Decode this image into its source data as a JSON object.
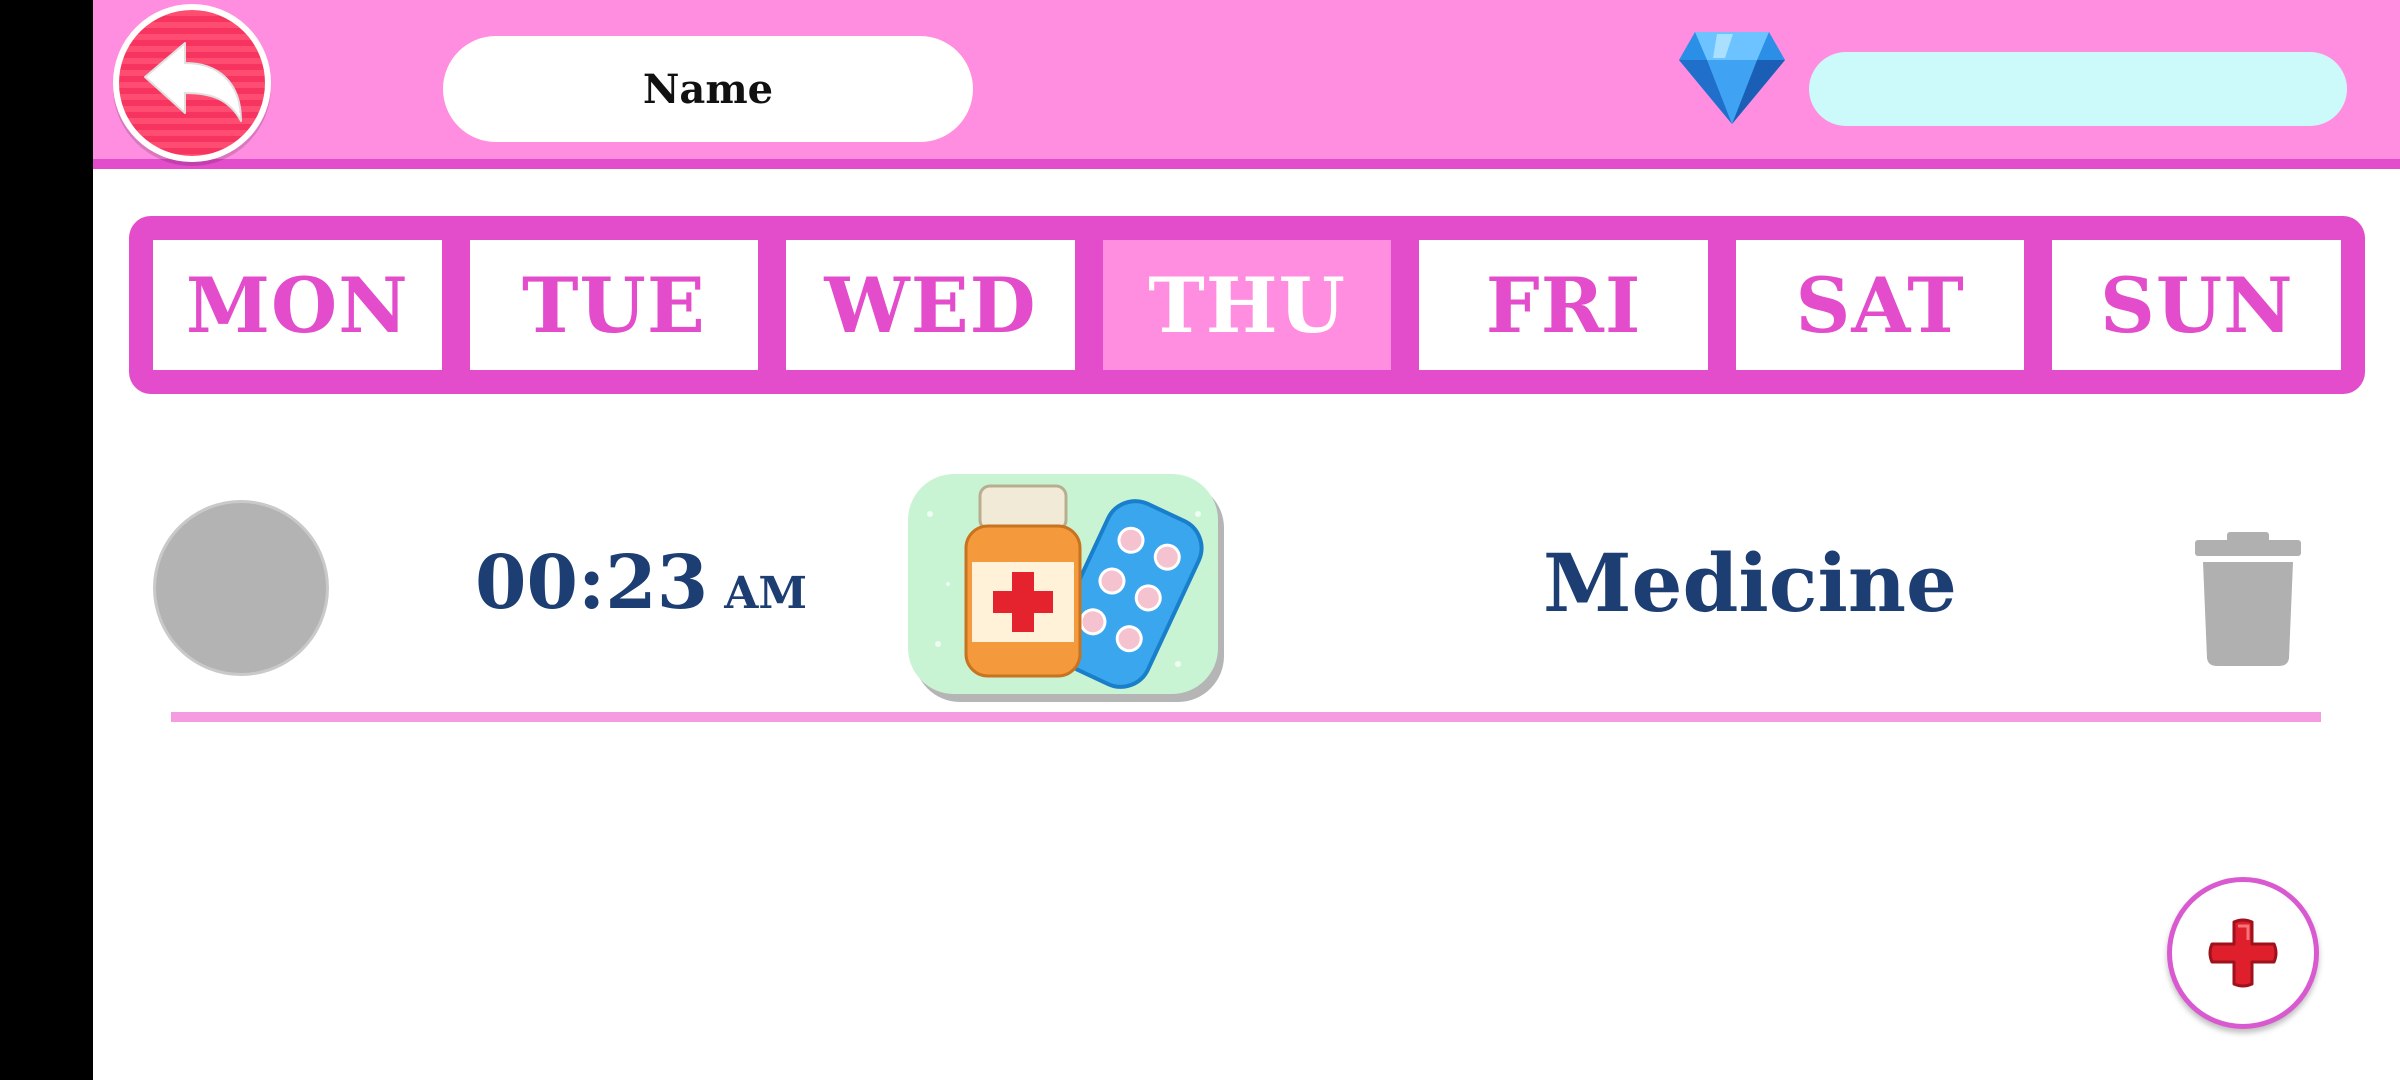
{
  "header": {
    "name_label": "Name",
    "back_icon": "back-arrow-icon",
    "gem_icon": "diamond-icon",
    "gem_value": ""
  },
  "days": [
    {
      "label": "MON",
      "active": false
    },
    {
      "label": "TUE",
      "active": false
    },
    {
      "label": "WED",
      "active": false
    },
    {
      "label": "THU",
      "active": true
    },
    {
      "label": "FRI",
      "active": false
    },
    {
      "label": "SAT",
      "active": false
    },
    {
      "label": "SUN",
      "active": false
    }
  ],
  "reminder": {
    "time": "00:23",
    "ampm": "AM",
    "title": "Medicine",
    "image_icon": "medicine-bottle-pills-icon",
    "delete_icon": "trash-icon"
  },
  "add_icon": "plus-icon",
  "colors": {
    "header_bg": "#ff8ee0",
    "accent_pink": "#e34ccb",
    "text_navy": "#1d3e73",
    "gem_bar": "#ccfafb",
    "back_red": "#f7345f"
  }
}
